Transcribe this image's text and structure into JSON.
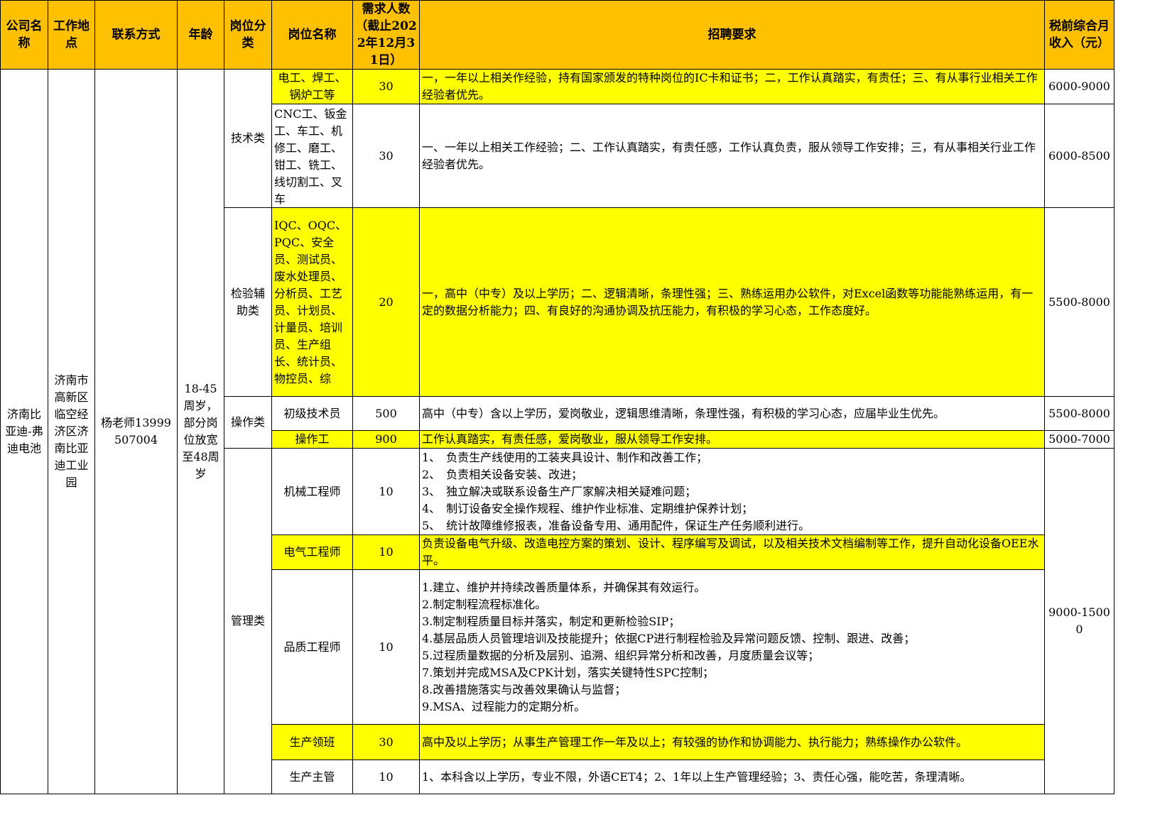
{
  "headers": {
    "company": "公司名称",
    "location": "工作地点",
    "contact": "联系方式",
    "age": "年龄",
    "category": "岗位分类",
    "position": "岗位名称",
    "count": "需求人数（截止2022年12月31日）",
    "requirements": "招聘要求",
    "salary": "税前综合月收入（元）"
  },
  "company": "济南比亚迪-弗迪电池",
  "location": "济南市高新区临空经济区济南比亚迪工业园",
  "contact": "杨老师13999507004",
  "age": "18-45周岁，部分岗位放宽至48周岁",
  "categories": {
    "tech": "技术类",
    "inspection": "检验辅助类",
    "operation": "操作类",
    "management": "管理类"
  },
  "rows": [
    {
      "position": "电工、焊工、锅炉工等",
      "count": "30",
      "requirement": "一，一年以上相关作经验，持有国家颁发的特种岗位的IC卡和证书；二，工作认真踏实，有责任；三、有从事行业相关工作经验者优先。",
      "salary": "6000-9000"
    },
    {
      "position": "CNC工、钣金工、车工、机修工、磨工、钳工、铣工、线切割工、叉车",
      "count": "30",
      "requirement": "一、一年以上相关工作经验；二、工作认真踏实，有责任感，工作认真负责，服从领导工作安排；三，有从事相关行业工作经验者优先。",
      "salary": "6000-8500"
    },
    {
      "position": "IQC、OQC、PQC、安全员、测试员、废水处理员、分析员、工艺员、计划员、计量员、培训员、生产组长、统计员、物控员、综",
      "count": "20",
      "requirement": "一，高中（中专）及以上学历；二、逻辑清晰，条理性强；三、熟练运用办公软件，对Excel函数等功能能熟练运用，有一定的数据分析能力；四、有良好的沟通协调及抗压能力，有积极的学习心态，工作态度好。",
      "salary": "5500-8000"
    },
    {
      "position": "初级技术员",
      "count": "500",
      "requirement": "高中（中专）含以上学历，爱岗敬业，逻辑思维清晰，条理性强，有积极的学习心态，应届毕业生优先。",
      "salary": "5500-8000"
    },
    {
      "position": "操作工",
      "count": "900",
      "requirement": "工作认真踏实，有责任感，爱岗敬业，服从领导工作安排。",
      "salary": "5000-7000"
    },
    {
      "position": "机械工程师",
      "count": "10",
      "requirement_lines": [
        "1、　负责生产线使用的工装夹具设计、制作和改善工作；",
        "2、　负责相关设备安装、改进；",
        "3、　独立解决或联系设备生产厂家解决相关疑难问题；",
        "4、　制订设备安全操作规程、维护作业标准、定期维护保养计划；",
        "5、　统计故障维修报表，准备设备专用、通用配件，保证生产任务顺利进行。"
      ]
    },
    {
      "position": "电气工程师",
      "count": "10",
      "requirement": "负责设备电气升级、改造电控方案的策划、设计、程序编写及调试，以及相关技术文档编制等工作，提升自动化设备OEE水平。"
    },
    {
      "position": "品质工程师",
      "count": "10",
      "requirement_lines": [
        "1.建立、维护并持续改善质量体系，并确保其有效运行。",
        "2.制定制程流程标准化。",
        "3.制定制程质量目标并落实，制定和更新检验SIP；",
        "4.基层品质人员管理培训及技能提升；依据CP进行制程检验及异常问题反馈、控制、跟进、改善；",
        "5.过程质量数据的分析及层别、追溯、组织异常分析和改善，月度质量会议等；",
        "7.策划并完成MSA及CPK计划，落实关键特性SPC控制；",
        "8.改善措施落实与改善效果确认与监督；",
        "9.MSA、过程能力的定期分析。"
      ]
    },
    {
      "position": "生产领班",
      "count": "30",
      "requirement": "高中及以上学历；从事生产管理工作一年及以上；有较强的协作和协调能力、执行能力；熟练操作办公软件。"
    },
    {
      "position": "生产主管",
      "count": "10",
      "requirement": "1、本科含以上学历，专业不限，外语CET4；2、1年以上生产管理经验；3、责任心强，能吃苦，条理清晰。"
    }
  ],
  "management_salary": "9000-15000",
  "colors": {
    "header_fill": "#FFC000",
    "highlight_fill": "#FFFF00",
    "border": "#000000"
  }
}
